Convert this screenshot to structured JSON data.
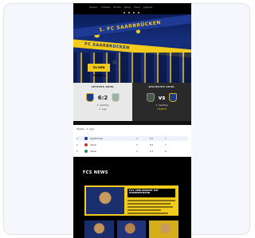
{
  "nav": {
    "links": [
      "Verein",
      "Tickets",
      "Profis",
      "Shop",
      "Fans",
      "Jugend"
    ],
    "slides": 4
  },
  "hero": {
    "banner_text": "1. FC SAARBRÜCKEN",
    "banner2_text": "FC SAARBRÜCKEN",
    "ticket_button": "ZU DEN TICKETS"
  },
  "last_match": {
    "label": "LETZTES SPIEL",
    "score": "6:2",
    "line1": "3. Spieltag",
    "line2": "3. Liga"
  },
  "next_match": {
    "label": "NÄCHSTES SPIEL",
    "score": "vs",
    "line1": "3. Spieltag",
    "line2": "TICKETS"
  },
  "table": {
    "header": "TABELLE",
    "crumb": "Tabelle · 3. Liga",
    "rows": [
      {
        "pos": "1",
        "club": "Saarbrücken",
        "sp": "3",
        "tore": "9:3",
        "pkt": "7"
      },
      {
        "pos": "2",
        "club": "Verein",
        "sp": "3",
        "tore": "6:2",
        "pkt": "7"
      },
      {
        "pos": "3",
        "club": "Verein",
        "sp": "3",
        "tore": "5:3",
        "pkt": "6"
      }
    ]
  },
  "news": {
    "title": "FCS NEWS",
    "feature_headline": "FCS VERLÄNGERT MIT STAMMSPIELER"
  },
  "colors": {
    "brand_yellow": "#f3cb1d",
    "brand_blue": "#1a3b8f",
    "page_bg": "#000000"
  }
}
